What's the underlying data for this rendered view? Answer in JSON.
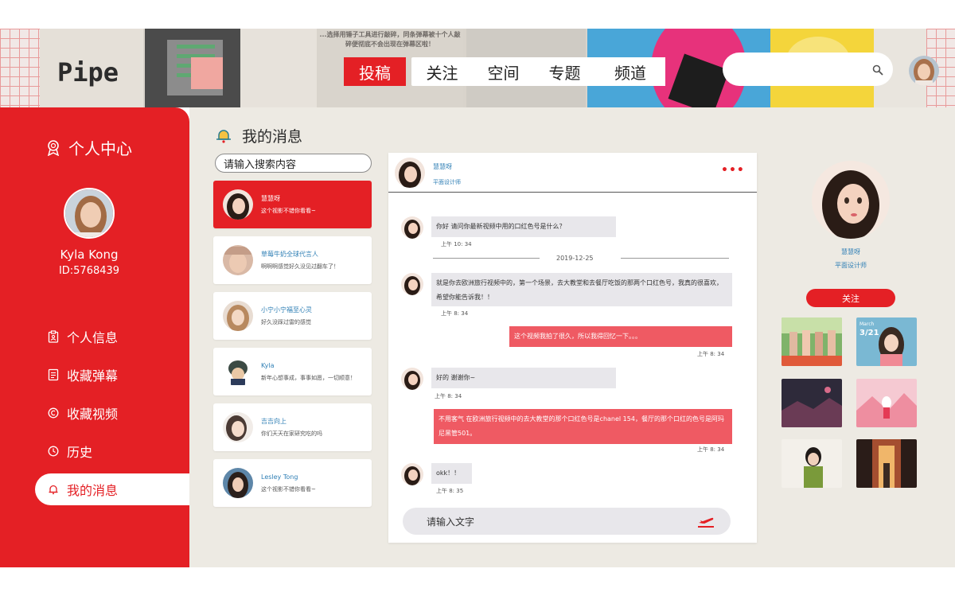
{
  "header": {
    "logo": "Pipe",
    "tagline": "...选择用锤子工具进行敲碎，同条弹幕被十个人敲碎便彻底不会出现在弹幕区啦！",
    "nav": [
      "投稿",
      "关注",
      "空间",
      "专题",
      "频道"
    ],
    "search_placeholder": "",
    "search_icon": "search-icon"
  },
  "sidebar": {
    "title": "个人中心",
    "user_name": "Kyla Kong",
    "user_id": "ID:5768439",
    "items": [
      {
        "label": "个人信息",
        "icon": "clipboard-icon"
      },
      {
        "label": "收藏弹幕",
        "icon": "list-doc-icon"
      },
      {
        "label": "收藏视频",
        "icon": "copyright-icon"
      },
      {
        "label": "历史",
        "icon": "clock-icon"
      },
      {
        "label": "我的消息",
        "icon": "bell-icon",
        "active": true
      }
    ]
  },
  "main": {
    "title": "我的消息",
    "search_placeholder": "请输入搜索内容",
    "conversations": [
      {
        "name": "慧慧呀",
        "message": "这个视影不错你看看~"
      },
      {
        "name": "草莓牛奶全球代言人",
        "message": "啊啊啊感觉好久没见过翻车了！"
      },
      {
        "name": "小宁小宁福至心灵",
        "message": "好久没踩过雷的感觉"
      },
      {
        "name": "Kyla",
        "message": "新年心想事成，事事如愿，一切顺意！"
      },
      {
        "name": "吉吉向上",
        "message": "你们天天在家研究吃的吗"
      },
      {
        "name": "Lesley Tong",
        "message": "这个视影不错你看看~"
      }
    ]
  },
  "chat": {
    "contact_name": "慧慧呀",
    "contact_role": "平面设计师",
    "more": "•••",
    "date_divider": "2019-12-25",
    "messages": [
      {
        "dir": "in",
        "text": "你好 请问你最新视频中用的口红色号是什么？",
        "time": "上午 10: 34"
      },
      {
        "dir": "in",
        "text": "就是你去欧洲旅行视频中的，第一个场景，去大教堂和去餐厅吃饭的那两个口红色号，我真的很喜欢，希望你能告诉我！！",
        "time": "上午 8: 34"
      },
      {
        "dir": "out",
        "text": "这个视频我拍了很久，所以我得回忆一下。。。",
        "time": "上午 8: 34"
      },
      {
        "dir": "in",
        "text": "好的 谢谢你~",
        "time": "上午 8: 34"
      },
      {
        "dir": "out",
        "text": "不用客气 在欧洲旅行视频中的去大教堂的那个口红色号是chanel 154，餐厅的那个口红的色号是阿玛尼黑管501。",
        "time": "上午 8: 34"
      },
      {
        "dir": "in",
        "text": "okk！！",
        "time": "上午 8: 35"
      }
    ],
    "input_placeholder": "请输入文字"
  },
  "profile": {
    "name": "慧慧呀",
    "role": "平面设计师",
    "follow_label": "关注",
    "thumb_march": "March",
    "thumb_date": "3/21"
  },
  "colors": {
    "brand_red": "#e42025",
    "bubble_out": "#ef5a63",
    "bubble_in": "#e8e7eb",
    "main_bg": "#edeae3",
    "link_blue": "#2f7fb5"
  }
}
